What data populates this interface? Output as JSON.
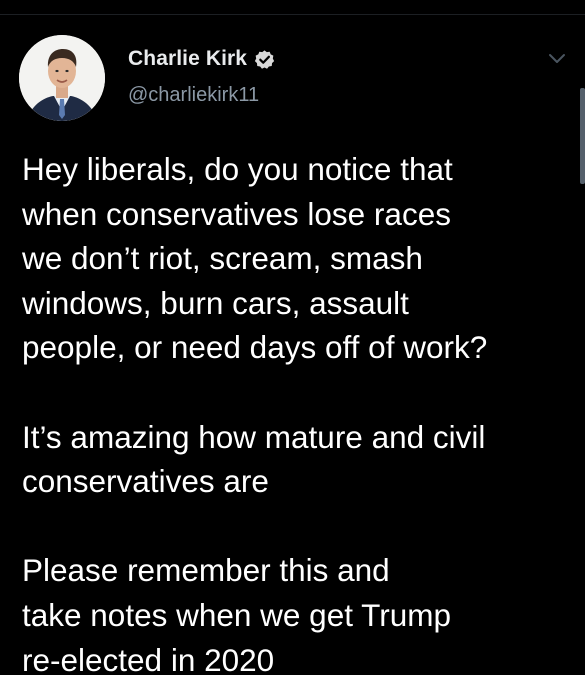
{
  "colors": {
    "background": "#000000",
    "text_primary": "#ffffff",
    "text_secondary": "#8b98a5",
    "verified_badge": "#d9d9d9"
  },
  "tweet": {
    "author": {
      "display_name": "Charlie Kirk",
      "handle": "@charliekirk11",
      "verified": true,
      "verified_icon": "verified-badge-icon",
      "avatar_icon": "profile-photo"
    },
    "menu_icon": "chevron-down-icon",
    "paragraphs": [
      "Hey liberals, do you notice that\nwhen conservatives lose races\nwe don’t riot, scream, smash\nwindows, burn cars, assault\npeople, or need days off of work?",
      "It’s amazing how mature and civil\nconservatives are",
      "Please remember this and\ntake notes when we get Trump\nre-elected in 2020"
    ]
  }
}
